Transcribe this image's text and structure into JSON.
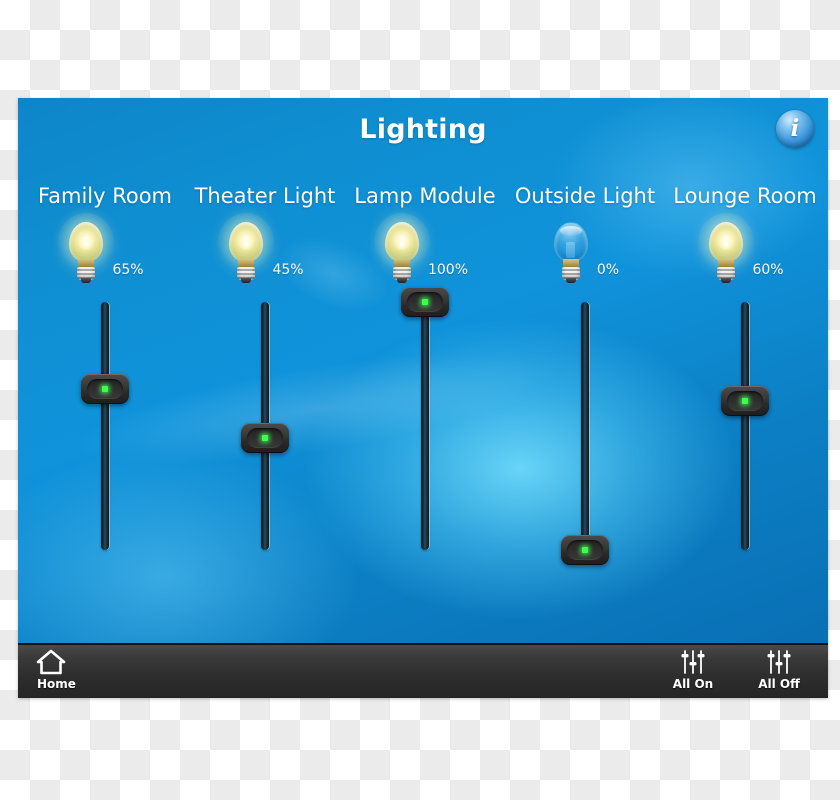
{
  "header": {
    "title": "Lighting",
    "info_icon": "info-circle-icon",
    "info_label": "i"
  },
  "theme": {
    "screen_blue": "#0f8fd2",
    "screen_blue_dark": "#0a6fb4",
    "glow_cyan": "#78e2ff",
    "toolbar_dark": "#2e2e2e",
    "led_green": "#3dff4a",
    "text_white": "#ffffff"
  },
  "channels": [
    {
      "name": "Family Room",
      "percent_label": "65%",
      "percent": 65,
      "state": "on",
      "bulb_icon": "lightbulb-on-icon",
      "slider_name": "family-room-slider"
    },
    {
      "name": "Theater Light",
      "percent_label": "45%",
      "percent": 45,
      "state": "on",
      "bulb_icon": "lightbulb-on-icon",
      "slider_name": "theater-light-slider"
    },
    {
      "name": "Lamp Module",
      "percent_label": "100%",
      "percent": 100,
      "state": "on",
      "bulb_icon": "lightbulb-on-icon",
      "slider_name": "lamp-module-slider"
    },
    {
      "name": "Outside Light",
      "percent_label": "0%",
      "percent": 0,
      "state": "off",
      "bulb_icon": "lightbulb-off-icon",
      "slider_name": "outside-light-slider"
    },
    {
      "name": "Lounge Room",
      "percent_label": "60%",
      "percent": 60,
      "state": "on",
      "bulb_icon": "lightbulb-on-icon",
      "slider_name": "lounge-room-slider"
    }
  ],
  "toolbar": {
    "home_label": "Home",
    "home_icon": "house-icon",
    "all_on_label": "All On",
    "all_on_icon": "sliders-icon",
    "all_off_label": "All Off",
    "all_off_icon": "sliders-icon"
  }
}
